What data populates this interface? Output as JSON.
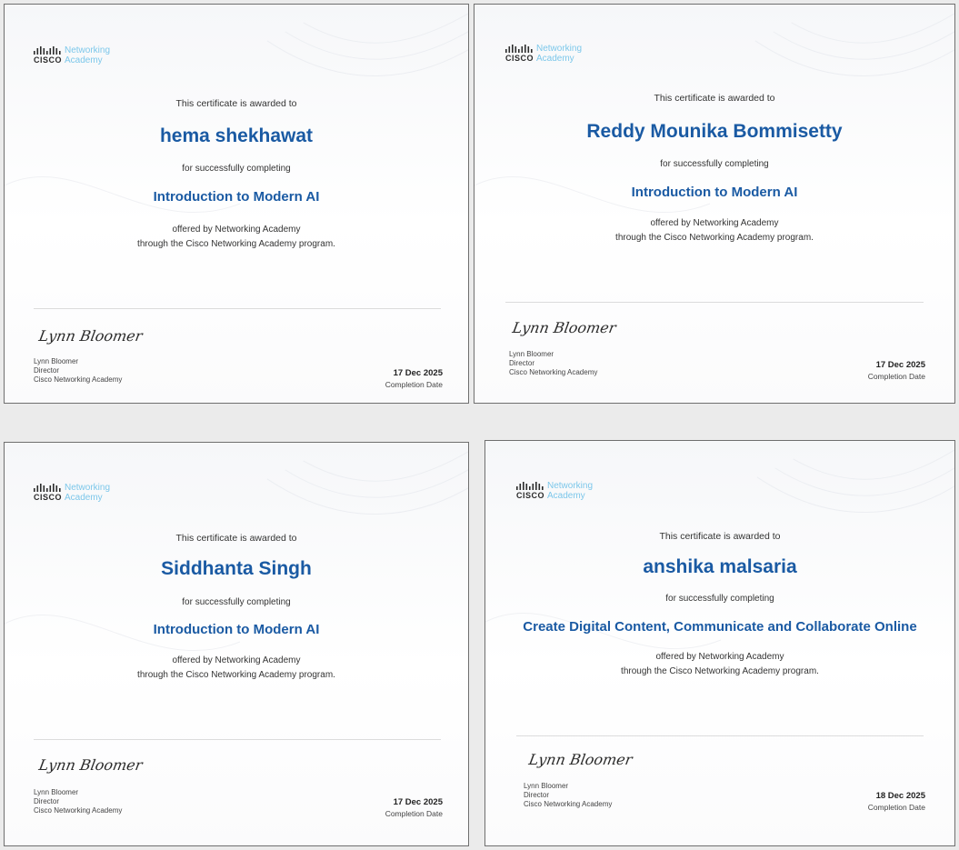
{
  "common": {
    "logo_brand": "CISCO",
    "logo_line1": "Networking",
    "logo_line2": "Academy",
    "awarded_text": "This certificate is awarded to",
    "completing_text": "for successfully completing",
    "offered_line1": "offered by Networking Academy",
    "offered_line2": "through the Cisco Networking Academy program.",
    "signature_script": "Lynn Bloomer",
    "signer_name": "Lynn Bloomer",
    "signer_title": "Director",
    "signer_org": "Cisco Networking Academy",
    "date_label": "Completion Date",
    "colors": {
      "accent_blue": "#1a5aa3",
      "logo_cyan": "#7cc7ea",
      "background": "#ebebeb",
      "card": "#ffffff"
    }
  },
  "certificates": [
    {
      "recipient": "hema shekhawat",
      "course": "Introduction to Modern AI",
      "date": "17 Dec 2025"
    },
    {
      "recipient": "Reddy Mounika Bommisetty",
      "course": "Introduction to Modern AI",
      "date": "17 Dec 2025"
    },
    {
      "recipient": "Siddhanta Singh",
      "course": "Introduction to Modern AI",
      "date": "17 Dec 2025"
    },
    {
      "recipient": "anshika malsaria",
      "course": "Create Digital Content, Communicate and Collaborate Online",
      "date": "18 Dec 2025"
    }
  ]
}
